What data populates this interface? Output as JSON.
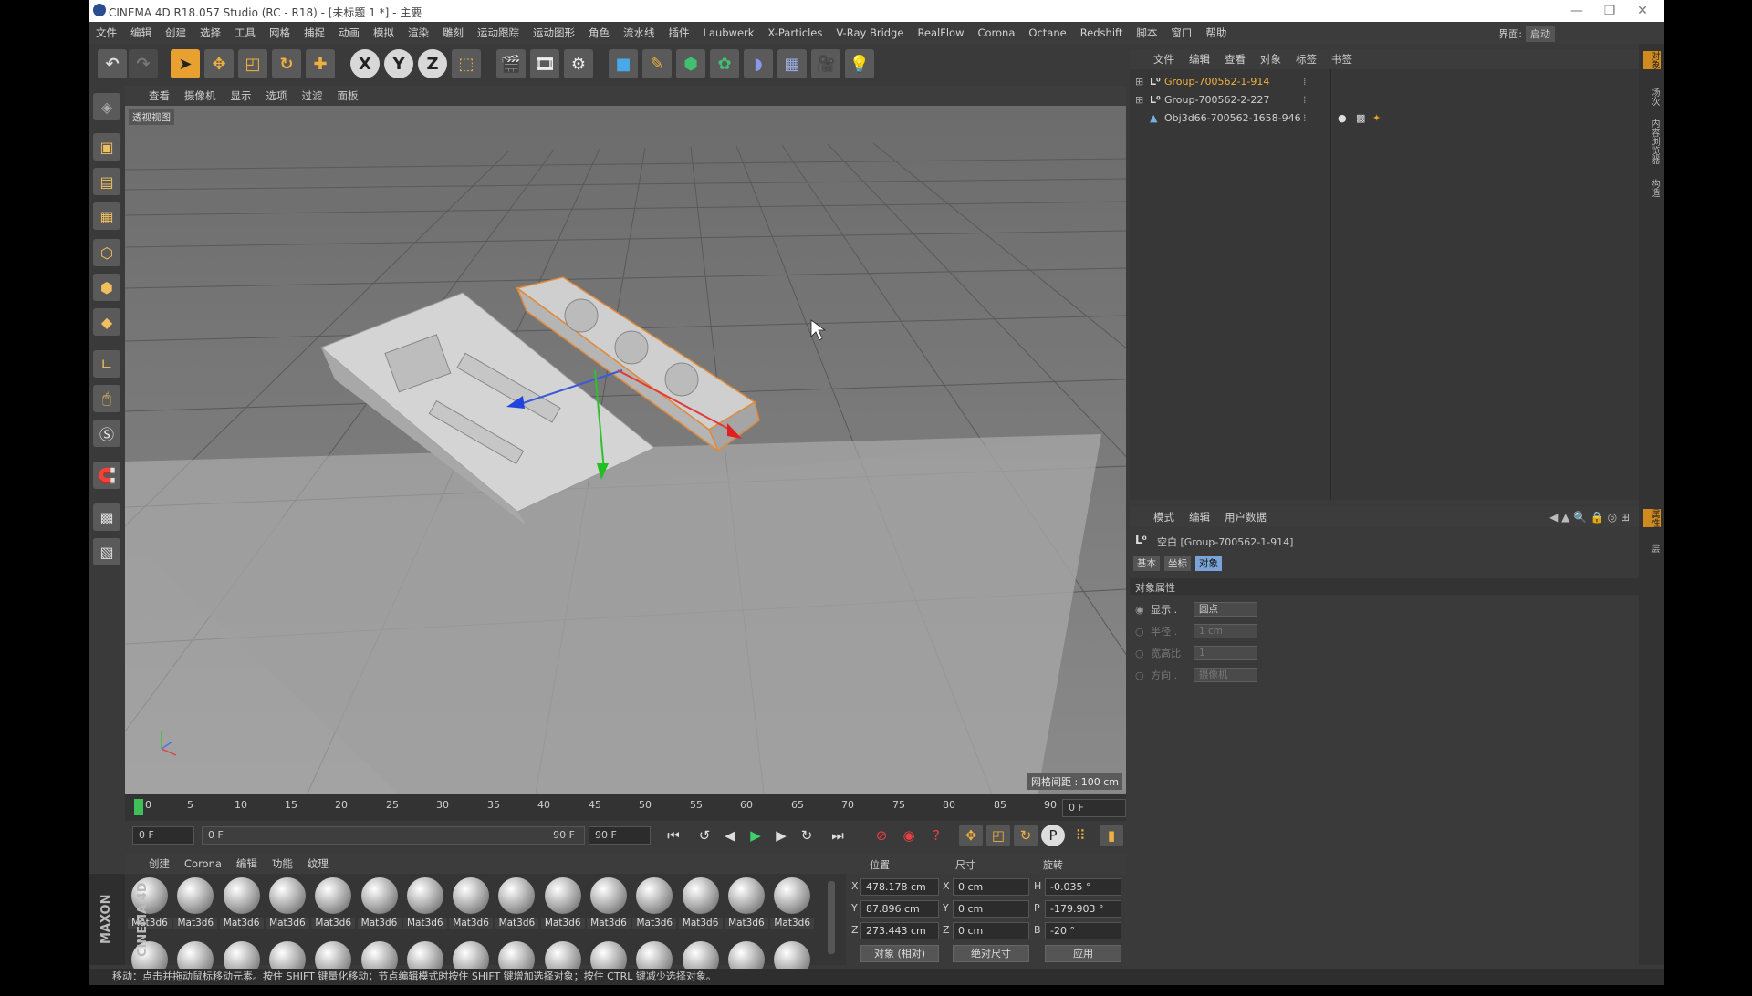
{
  "window": {
    "title": "CINEMA 4D R18.057 Studio (RC - R18) - [未标题 1 *] - 主要",
    "minimize": "—",
    "restore": "❐",
    "close": "✕"
  },
  "menubar": {
    "items": [
      "文件",
      "编辑",
      "创建",
      "选择",
      "工具",
      "网格",
      "捕捉",
      "动画",
      "模拟",
      "渲染",
      "雕刻",
      "运动跟踪",
      "运动图形",
      "角色",
      "流水线",
      "插件",
      "Laubwerk",
      "X-Particles",
      "V-Ray Bridge",
      "RealFlow",
      "Corona",
      "Octane",
      "Redshift",
      "脚本",
      "窗口",
      "帮助"
    ],
    "layout_label": "界面:",
    "layout_value": "启动"
  },
  "toolbar": {
    "icons": [
      "undo-icon",
      "redo-icon",
      "select-arrow-icon",
      "move-icon",
      "scale-icon",
      "rotate-icon",
      "add-icon",
      "x-axis-icon",
      "y-axis-icon",
      "z-axis-icon",
      "coordinate-system-icon",
      "render-view-icon",
      "render-picture-viewer-icon",
      "render-settings-icon",
      "cube-icon",
      "pen-icon",
      "subdivision-icon",
      "array-icon",
      "deformer-icon",
      "floor-icon",
      "camera-icon",
      "light-icon"
    ],
    "x": "X",
    "y": "Y",
    "z": "Z"
  },
  "viewport": {
    "menu": [
      "查看",
      "摄像机",
      "显示",
      "选项",
      "过滤",
      "面板"
    ],
    "label": "透视视图",
    "grid_info": "网格间距 : 100 cm"
  },
  "timeline": {
    "ticks": [
      "0",
      "5",
      "10",
      "15",
      "20",
      "25",
      "30",
      "35",
      "40",
      "45",
      "50",
      "55",
      "60",
      "65",
      "70",
      "75",
      "80",
      "85",
      "90"
    ],
    "current_frame": "0 F",
    "start_frame": "0 F",
    "range_start": "0 F",
    "range_end": "90 F",
    "end_frame": "90 F"
  },
  "materials": {
    "menu": [
      "创建",
      "Corona",
      "编辑",
      "功能",
      "纹理"
    ],
    "label": "Mat3d6",
    "count": 15
  },
  "coordinates": {
    "headers": {
      "position": "位置",
      "size": "尺寸",
      "rotation": "旋转"
    },
    "pos": {
      "x": "478.178 cm",
      "y": "87.896 cm",
      "z": "273.443 cm"
    },
    "size": {
      "x": "0 cm",
      "y": "0 cm",
      "z": "0 cm"
    },
    "rot": {
      "h": "-0.035 °",
      "p": "-179.903 °",
      "b": "-20 °"
    },
    "axis_labels": {
      "x": "X",
      "y": "Y",
      "z": "Z",
      "h": "H",
      "p": "P",
      "b": "B"
    },
    "mode_object": "对象 (相对)",
    "mode_size": "绝对尺寸",
    "apply": "应用"
  },
  "object_manager": {
    "menu": [
      "文件",
      "编辑",
      "查看",
      "对象",
      "标签",
      "书签"
    ],
    "objects": [
      {
        "name": "Group-700562-1-914",
        "selected": true
      },
      {
        "name": "Group-700562-2-227",
        "selected": false
      },
      {
        "name": "Obj3d66-700562-1658-946",
        "selected": false
      }
    ]
  },
  "attributes": {
    "menu": [
      "模式",
      "编辑",
      "用户数据"
    ],
    "header": "空白 [Group-700562-1-914]",
    "tabs": [
      "基本",
      "坐标",
      "对象"
    ],
    "section": "对象属性",
    "rows": [
      {
        "label": "显示 .",
        "value": "圆点"
      },
      {
        "label": "半径 .",
        "value": "1 cm"
      },
      {
        "label": "宽高比",
        "value": "1"
      },
      {
        "label": "方向 .",
        "value": "摄像机"
      }
    ]
  },
  "right_strip": [
    "对象",
    "场次",
    "内容浏览器",
    "构造",
    "属性",
    "层"
  ],
  "logo_text": "MAXON CINEMA 4D",
  "status": "移动：点击并拖动鼠标移动元素。按住 SHIFT 键量化移动；节点编辑模式时按住 SHIFT 键增加选择对象；按住 CTRL 键减少选择对象。",
  "colors": {
    "accent_orange": "#f0a020",
    "selected_object": "#f0b040",
    "viewport_bg": "#7a7a7a",
    "panel_bg": "#3a3a3a"
  }
}
